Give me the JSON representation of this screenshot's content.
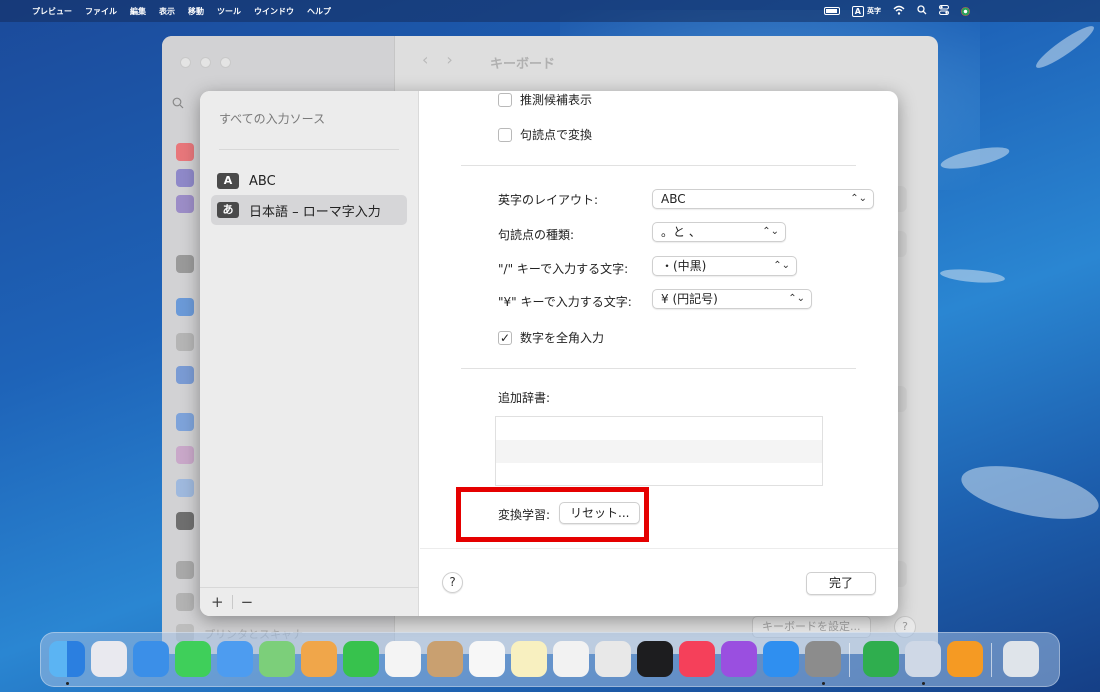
{
  "menubar": {
    "apple_glyph": "",
    "items": [
      "プレビュー",
      "ファイル",
      "編集",
      "表示",
      "移動",
      "ツール",
      "ウインドウ",
      "ヘルプ"
    ],
    "input_indicator_box": "A",
    "input_indicator_label": "英字"
  },
  "background_window": {
    "title": "キーボード",
    "sidebar_bottom_item": "プリンタとスキャナ",
    "keyboard_setup_button": "キーボードを設定...",
    "help_label": "?"
  },
  "sheet": {
    "left": {
      "heading": "すべての入力ソース",
      "sources": [
        {
          "badge": "A",
          "label": "ABC"
        },
        {
          "badge": "あ",
          "label": "日本語 – ローマ字入力"
        }
      ],
      "add_label": "+",
      "remove_label": "−"
    },
    "right": {
      "checkbox_predictive": "推測候補表示",
      "checkbox_punct_convert": "句読点で変換",
      "layout_label": "英字のレイアウト:",
      "layout_value": "ABC",
      "punct_label": "句読点の種類:",
      "punct_value": "。と 、",
      "slash_label": "\"/\" キーで入力する文字:",
      "slash_value": "・(中黒)",
      "yen_label": "\"¥\" キーで入力する文字:",
      "yen_value": "¥ (円記号)",
      "checkbox_fullwidth_numbers": "数字を全角入力",
      "checkbox_fullwidth_checked": "✓",
      "dictionary_label": "追加辞書:",
      "learning_label": "変換学習:",
      "reset_button": "リセット...",
      "help_button": "?",
      "done_button": "完了"
    }
  },
  "colors": {
    "highlight": "#e50000",
    "desktop_blue": "#1e63b8"
  }
}
